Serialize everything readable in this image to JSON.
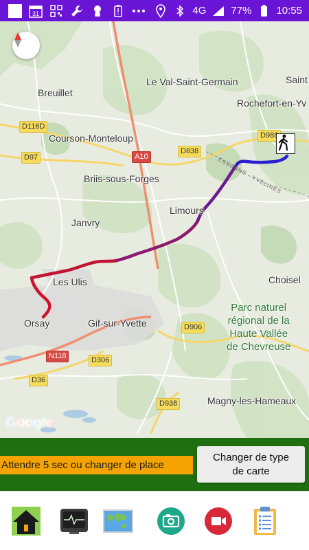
{
  "status_bar": {
    "calendar_day": "31",
    "signal": "4G",
    "battery": "77%",
    "time": "10:55",
    "icons": [
      "app-square-icon",
      "calendar-icon",
      "qr-icon",
      "wrench-icon",
      "keyhole-icon",
      "battery-alert-icon",
      "more-icon",
      "location-icon",
      "bluetooth-icon",
      "signal-icon",
      "battery-icon"
    ],
    "background_color": "#6a14d6"
  },
  "map": {
    "places": {
      "saint": "Saint",
      "breuillet": "Breuillet",
      "val_saint_germain": "Le Val-Saint-Germain",
      "rochefort": "Rochefort-en-Yv",
      "courson": "Courson-Monteloup",
      "briis": "Briis-sous-Forges",
      "janvry": "Janvry",
      "limours": "Limours",
      "les_ulis": "Les Ulis",
      "choisel": "Choisel",
      "orsay": "Orsay",
      "gif": "Gif-sur-Yvette",
      "magny": "Magny-les-Hameaux"
    },
    "park_lines": [
      "Parc naturel",
      "régional de la",
      "Haute Vallée",
      "de Chevreuse"
    ],
    "roads": {
      "d116d": "D116D",
      "a10": "A10",
      "d838": "D838",
      "d988": "D988",
      "d97": "D97",
      "d906": "D906",
      "n118": "N118",
      "d306": "D306",
      "d36": "D36",
      "d938": "D938"
    },
    "department_border": "ESSONNE · YVELINES",
    "attribution": "Google",
    "route_colors": [
      "#d2112d",
      "#7a1a7a",
      "#5a1aa8",
      "#2a1fd0"
    ]
  },
  "controls": {
    "notice": "Attendre 5 sec ou changer de place",
    "maptype_line1": "Changer de type",
    "maptype_line2": "de carte",
    "bar_color": "#1f6f10",
    "notice_color": "#f4a300"
  },
  "toolbar": {
    "buttons": [
      "home-icon",
      "monitor-icon",
      "world-map-icon",
      "camera-icon",
      "video-icon",
      "clipboard-icon"
    ]
  }
}
